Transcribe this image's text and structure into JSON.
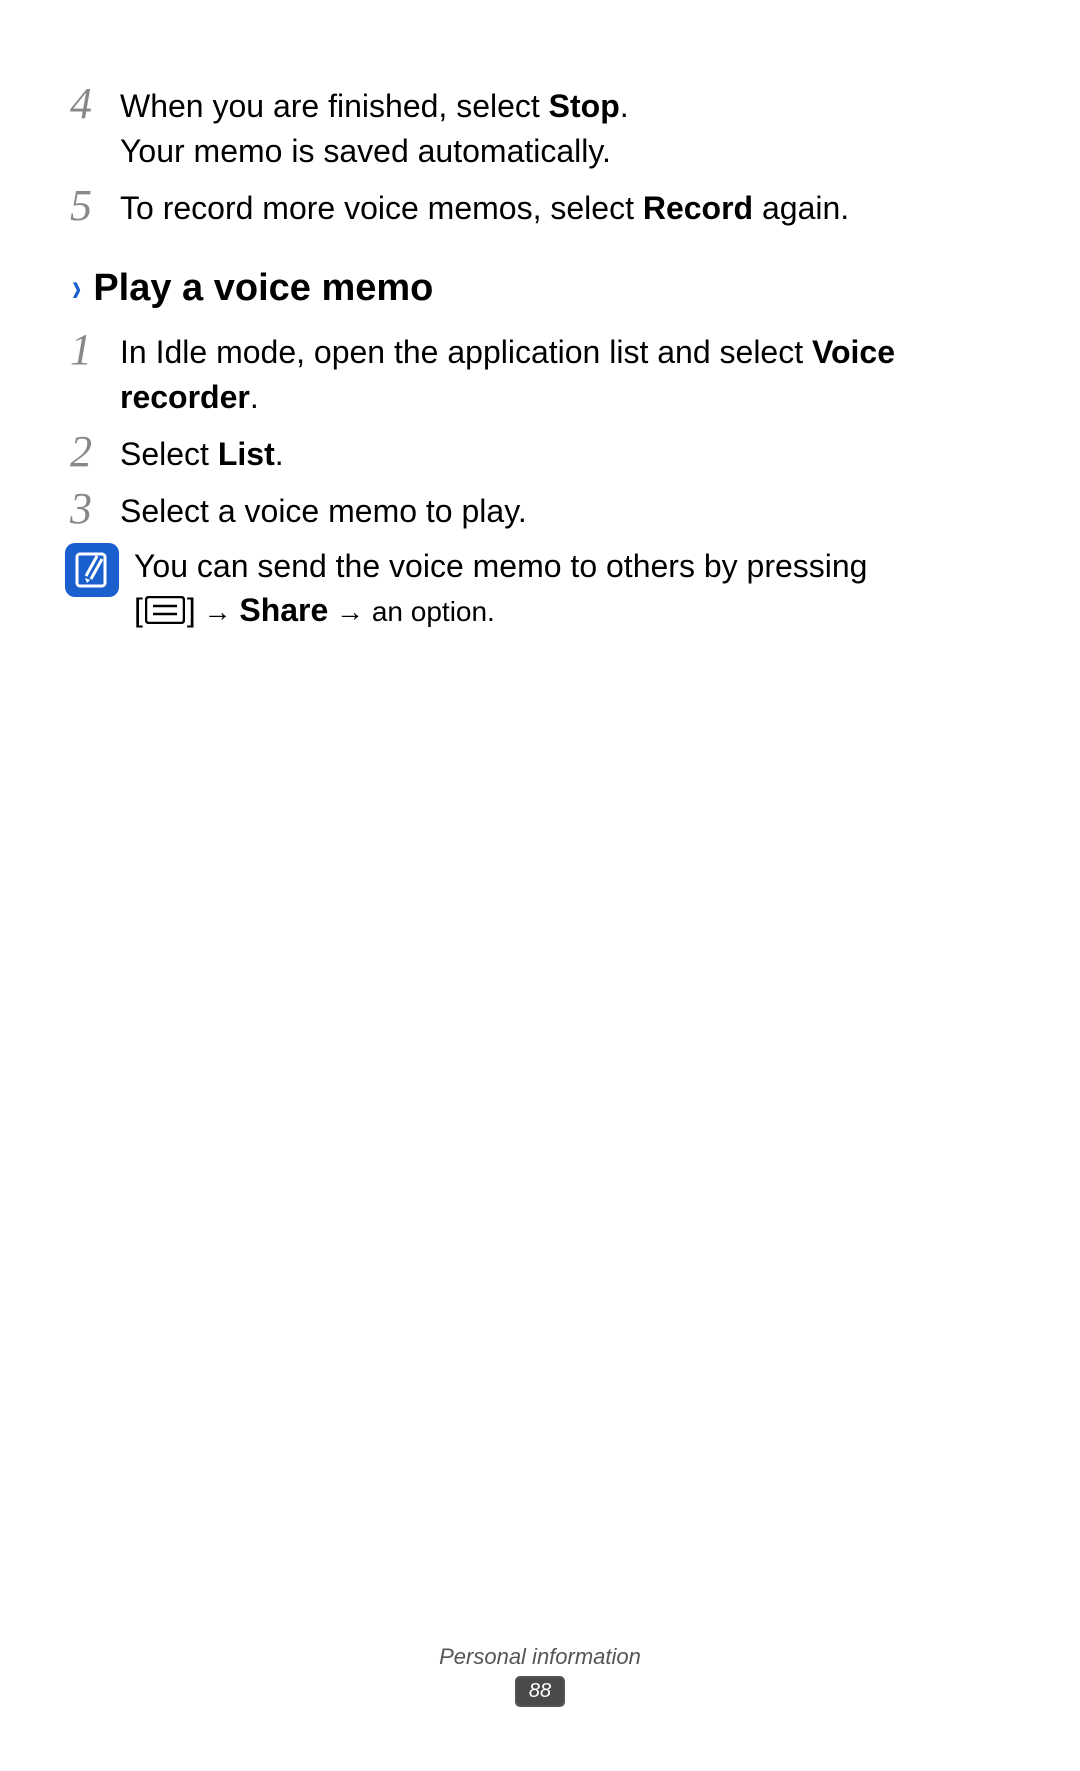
{
  "steps_top": [
    {
      "num": "4",
      "line1_pre": "When you are finished, select ",
      "line1_bold": "Stop",
      "line1_post": ".",
      "line2": "Your memo is saved automatically."
    },
    {
      "num": "5",
      "line1_pre": "To record more voice memos, select ",
      "line1_bold": "Record",
      "line1_post": " again."
    }
  ],
  "section": {
    "chevron": "›",
    "heading": "Play a voice memo"
  },
  "steps_bottom": [
    {
      "num": "1",
      "line1_pre": "In Idle mode, open the application list and select ",
      "line1_bold": "Voice recorder",
      "line1_post": "."
    },
    {
      "num": "2",
      "line1_pre": "Select ",
      "line1_bold": "List",
      "line1_post": "."
    },
    {
      "num": "3",
      "line1_pre": "Select a voice memo to play.",
      "line1_bold": "",
      "line1_post": ""
    }
  ],
  "note": {
    "line1": "You can send the voice memo to others by pressing",
    "bracket_open": "[",
    "bracket_close": "]",
    "arrow": " → ",
    "share": "Share",
    "tail": " → an option."
  },
  "footer": {
    "label": "Personal information",
    "page": "88"
  }
}
